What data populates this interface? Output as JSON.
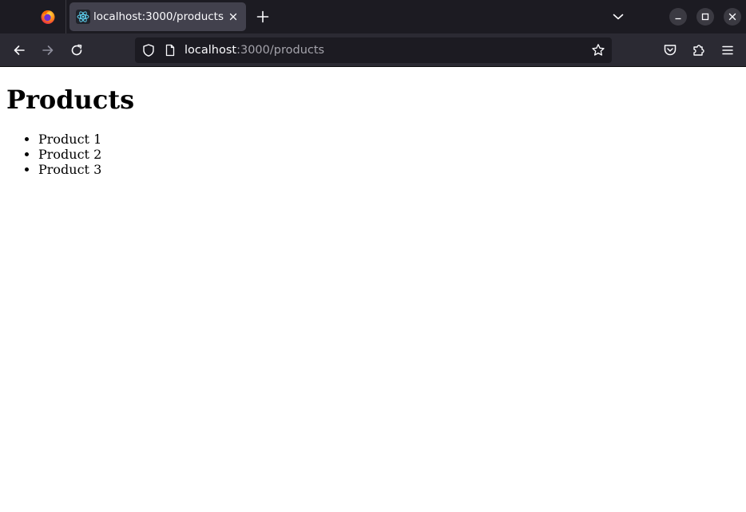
{
  "browser": {
    "tab": {
      "title": "localhost:3000/products"
    },
    "url": {
      "host": "localhost",
      "path": ":3000/products"
    },
    "icons": {
      "app_logo": "firefox-icon",
      "favicon": "react-icon",
      "close_tab": "close-icon",
      "new_tab": "plus-icon",
      "tab_list": "chevron-down-icon",
      "back": "arrow-left-icon",
      "forward": "arrow-right-icon",
      "reload": "reload-icon",
      "tracking": "shield-icon",
      "page": "page-icon",
      "bookmark": "star-icon",
      "pocket": "pocket-icon",
      "extensions": "puzzle-icon",
      "menu": "hamburger-icon"
    },
    "colors": {
      "tabstrip_bg": "#1c1b22",
      "active_tab_bg": "#42414d",
      "toolbar_bg": "#2b2a33",
      "urlbar_bg": "#1c1b22",
      "text": "#fbfbfe",
      "muted_text": "#a4a3ab"
    }
  },
  "page": {
    "title": "Products",
    "products": [
      "Product 1",
      "Product 2",
      "Product 3"
    ]
  }
}
